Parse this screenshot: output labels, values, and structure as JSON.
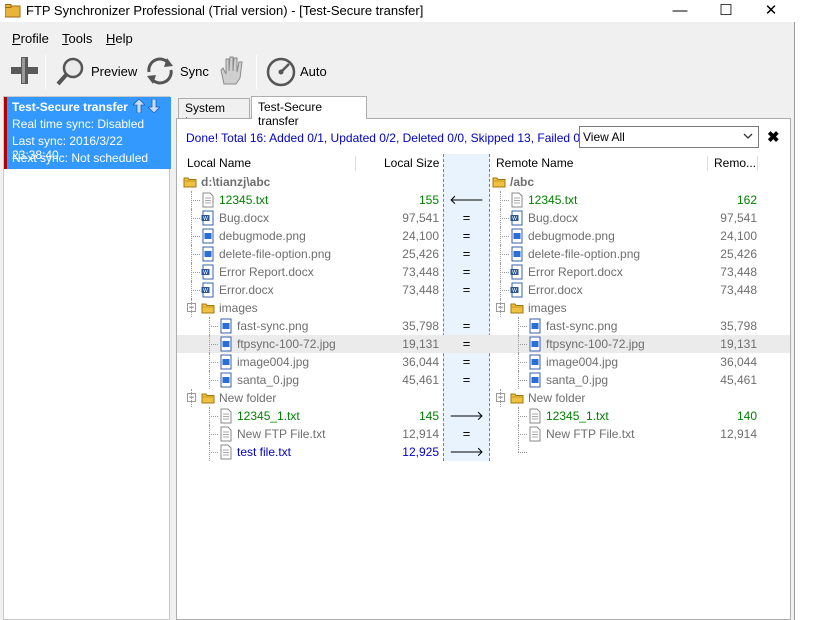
{
  "window": {
    "title": "FTP Synchronizer Professional (Trial version) - [Test-Secure transfer]",
    "controls": {
      "minimize": "—",
      "maximize": "☐",
      "close": "✕"
    }
  },
  "menu": {
    "items": [
      {
        "accel": "P",
        "rest": "rofile"
      },
      {
        "accel": "T",
        "rest": "ools"
      },
      {
        "accel": "H",
        "rest": "elp"
      }
    ]
  },
  "toolbar": {
    "add_icon": "plus-icon",
    "preview_label": "Preview",
    "sync_label": "Sync",
    "auto_label": "Auto"
  },
  "profile": {
    "name": "Test-Secure transfer",
    "realtime": "Real time sync: Disabled",
    "last_sync": "Last sync:  2016/3/22 23:38:40",
    "next_sync": "Next sync: Not scheduled",
    "accent": "#3399ff"
  },
  "tabs": [
    {
      "label": "System Log"
    },
    {
      "label": "Test-Secure transfer"
    }
  ],
  "status": {
    "text": "Done!  Total 16: Added 0/1, Updated 0/2, Deleted 0/0, Skipped 13, Failed 0",
    "filter_value": "View All",
    "close_symbol": "✖"
  },
  "grid": {
    "headers": {
      "local_name": "Local Name",
      "local_size": "Local Size",
      "remote_name": "Remote Name",
      "remote_size": "Remo..."
    },
    "rows": [
      {
        "local_name": "d:\\tianzj\\abc",
        "local_size": "",
        "cmp": "",
        "remote_name": "/abc",
        "remote_size": ""
      },
      {
        "local_name": "12345.txt",
        "local_size": "155",
        "cmp": "🡐",
        "remote_name": "12345.txt",
        "remote_size": "162"
      },
      {
        "local_name": "Bug.docx",
        "local_size": "97,541",
        "cmp": "=",
        "remote_name": "Bug.docx",
        "remote_size": "97,541"
      },
      {
        "local_name": "debugmode.png",
        "local_size": "24,100",
        "cmp": "=",
        "remote_name": "debugmode.png",
        "remote_size": "24,100"
      },
      {
        "local_name": "delete-file-option.png",
        "local_size": "25,426",
        "cmp": "=",
        "remote_name": "delete-file-option.png",
        "remote_size": "25,426"
      },
      {
        "local_name": "Error Report.docx",
        "local_size": "73,448",
        "cmp": "=",
        "remote_name": "Error Report.docx",
        "remote_size": "73,448"
      },
      {
        "local_name": "Error.docx",
        "local_size": "73,448",
        "cmp": "=",
        "remote_name": "Error.docx",
        "remote_size": "73,448"
      },
      {
        "local_name": "images",
        "local_size": "",
        "cmp": "",
        "remote_name": "images",
        "remote_size": ""
      },
      {
        "local_name": "fast-sync.png",
        "local_size": "35,798",
        "cmp": "=",
        "remote_name": "fast-sync.png",
        "remote_size": "35,798"
      },
      {
        "local_name": "ftpsync-100-72.jpg",
        "local_size": "19,131",
        "cmp": "=",
        "remote_name": "ftpsync-100-72.jpg",
        "remote_size": "19,131"
      },
      {
        "local_name": "image004.jpg",
        "local_size": "36,044",
        "cmp": "=",
        "remote_name": "image004.jpg",
        "remote_size": "36,044"
      },
      {
        "local_name": "santa_0.jpg",
        "local_size": "45,461",
        "cmp": "=",
        "remote_name": "santa_0.jpg",
        "remote_size": "45,461"
      },
      {
        "local_name": "New folder",
        "local_size": "",
        "cmp": "",
        "remote_name": "New folder",
        "remote_size": ""
      },
      {
        "local_name": "12345_1.txt",
        "local_size": "145",
        "cmp": "🡒",
        "remote_name": "12345_1.txt",
        "remote_size": "140"
      },
      {
        "local_name": "New FTP File.txt",
        "local_size": "12,914",
        "cmp": "=",
        "remote_name": "New FTP File.txt",
        "remote_size": "12,914"
      },
      {
        "local_name": "test file.txt",
        "local_size": "12,925",
        "cmp": "🡒",
        "remote_name": "",
        "remote_size": ""
      }
    ]
  },
  "colors": {
    "status_blue": "#0000c8",
    "updated_green": "#008000",
    "gray_text": "#6e6e6e",
    "strip_bg": "#e8f3fd"
  }
}
